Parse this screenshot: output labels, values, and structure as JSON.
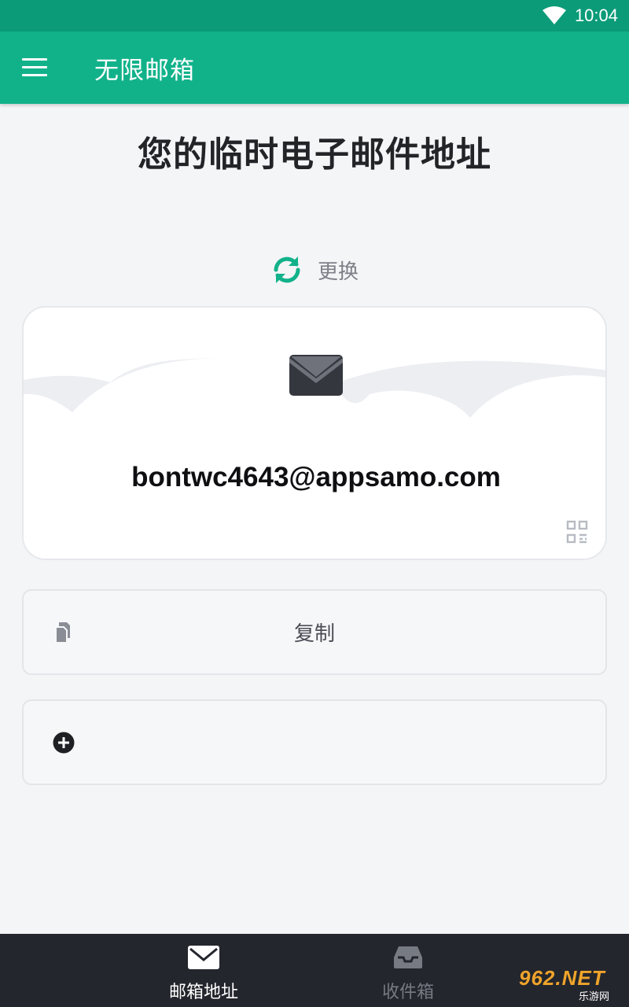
{
  "status_bar": {
    "time": "10:04",
    "wifi_icon": "wifi-icon"
  },
  "app_bar": {
    "menu_icon": "hamburger-menu-icon",
    "title": "无限邮箱"
  },
  "main": {
    "heading": "您的临时电子邮件地址",
    "refresh": {
      "icon": "refresh-icon",
      "label": "更换",
      "color": "#11b28a"
    },
    "email_card": {
      "icon": "envelope-icon",
      "address": "bontwc4643@appsamo.com",
      "qr_icon": "qr-code-icon"
    },
    "copy_button": {
      "icon": "copy-icon",
      "label": "复制"
    },
    "add_button": {
      "icon": "plus-circle-icon"
    }
  },
  "bottom_nav": {
    "items": [
      {
        "icon": "envelope-icon",
        "label": "邮箱地址",
        "active": true
      },
      {
        "icon": "inbox-icon",
        "label": "收件箱",
        "active": false
      }
    ]
  },
  "watermark": {
    "logo": "962.NET",
    "subtitle": "乐游网"
  },
  "colors": {
    "status_bar": "#0b9b78",
    "app_bar": "#11b28a",
    "background": "#f4f5f7",
    "bottom_nav": "#24262d"
  }
}
